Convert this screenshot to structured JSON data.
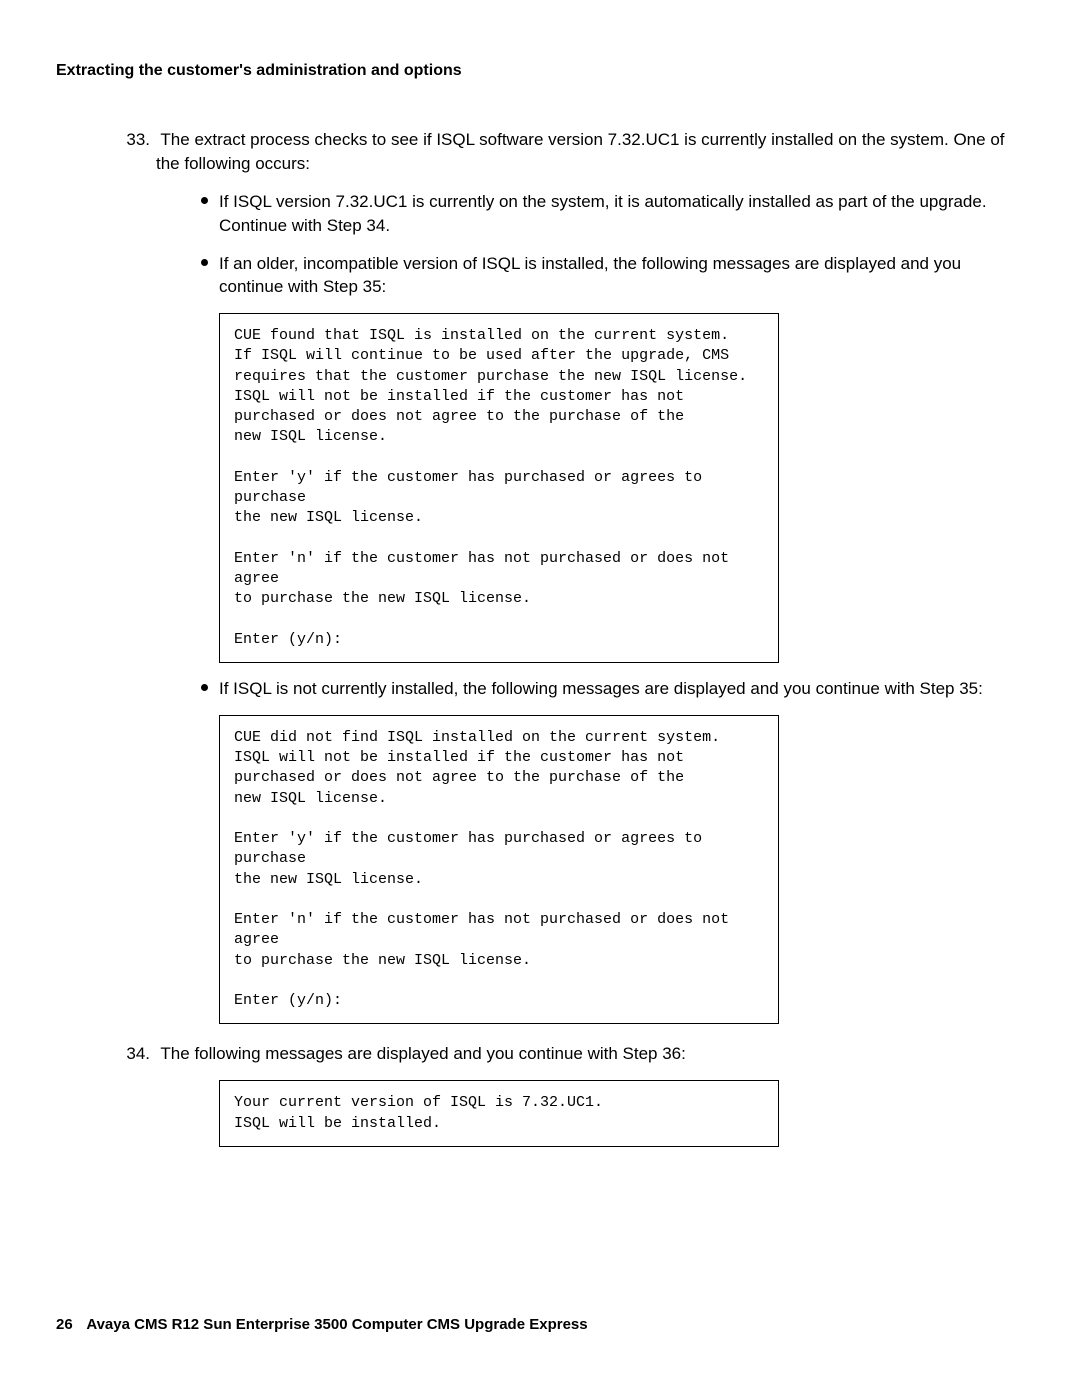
{
  "header": {
    "title": "Extracting the customer's administration and options"
  },
  "step33": {
    "number": "33.",
    "intro": "The extract process checks to see if ISQL software version 7.32.UC1 is currently installed on the system. One of the following occurs:",
    "bullet1": "If ISQL version 7.32.UC1 is currently on the system, it is automatically installed as part of the upgrade. Continue with Step 34.",
    "bullet2": "If an older, incompatible version of ISQL is installed, the following messages are displayed and you continue with Step 35:",
    "code1": "CUE found that ISQL is installed on the current system.\nIf ISQL will continue to be used after the upgrade, CMS\nrequires that the customer purchase the new ISQL license.\nISQL will not be installed if the customer has not\npurchased or does not agree to the purchase of the\nnew ISQL license.\n\nEnter 'y' if the customer has purchased or agrees to purchase\nthe new ISQL license.\n\nEnter 'n' if the customer has not purchased or does not agree\nto purchase the new ISQL license.\n\nEnter (y/n):",
    "bullet3": "If ISQL is not currently installed, the following messages are displayed and you continue with Step 35:",
    "code2": "CUE did not find ISQL installed on the current system.\nISQL will not be installed if the customer has not\npurchased or does not agree to the purchase of the\nnew ISQL license.\n\nEnter 'y' if the customer has purchased or agrees to purchase\nthe new ISQL license.\n\nEnter 'n' if the customer has not purchased or does not agree\nto purchase the new ISQL license.\n\nEnter (y/n):"
  },
  "step34": {
    "number": "34.",
    "intro": "The following messages are displayed and you continue with Step 36:",
    "code": "Your current version of ISQL is 7.32.UC1.\nISQL will be installed."
  },
  "footer": {
    "page": "26",
    "title": "Avaya CMS R12 Sun Enterprise 3500 Computer CMS Upgrade Express"
  }
}
